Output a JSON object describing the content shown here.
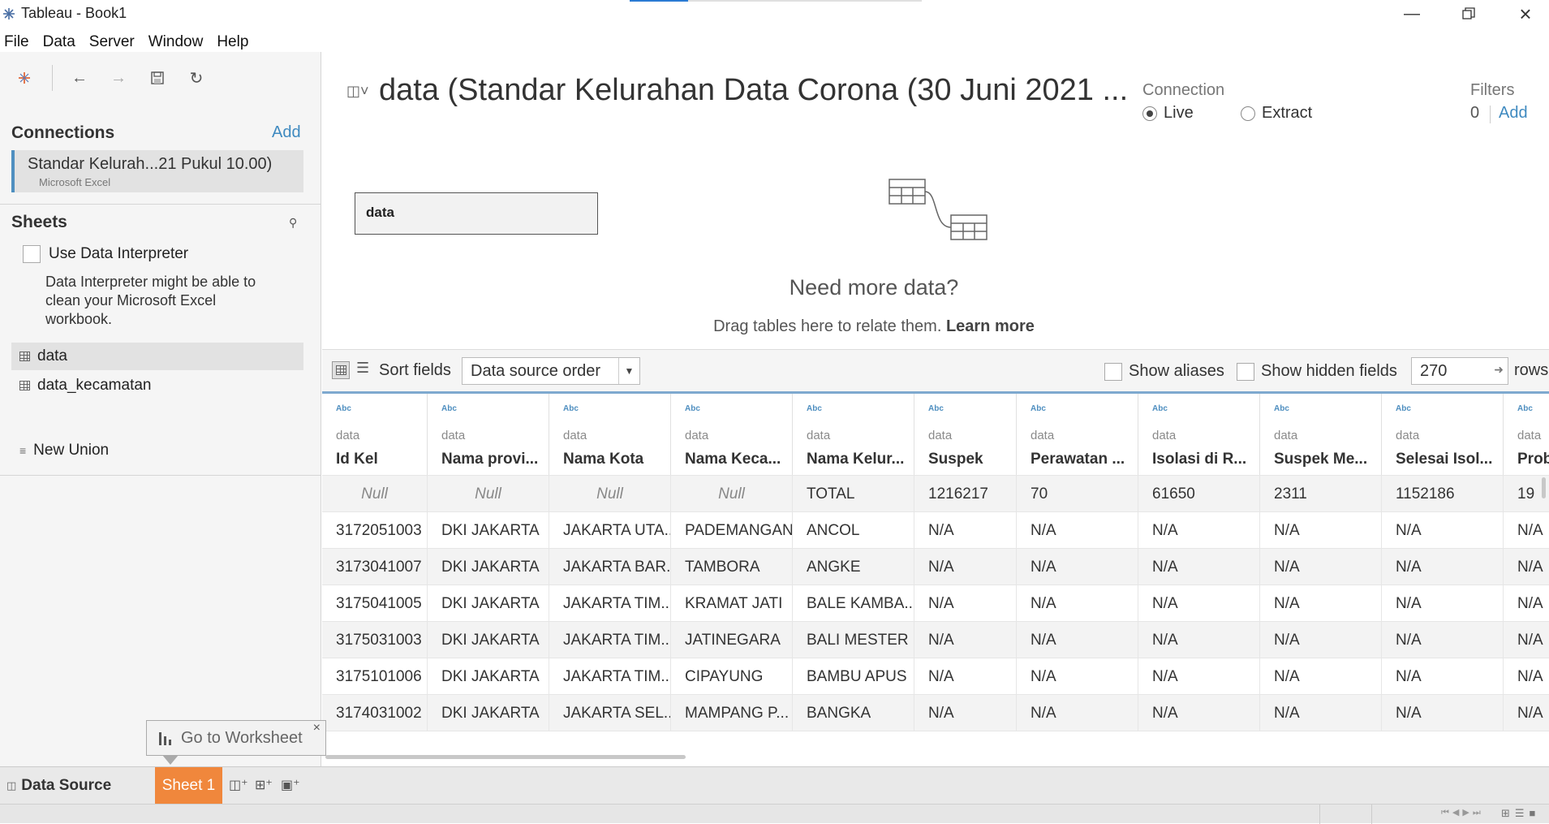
{
  "window": {
    "title": "Tableau - Book1"
  },
  "menu": [
    "File",
    "Data",
    "Server",
    "Window",
    "Help"
  ],
  "left": {
    "connections_heading": "Connections",
    "connections_add": "Add",
    "connection_name": "Standar Kelurah...21 Pukul 10.00)",
    "connection_type": "Microsoft Excel",
    "sheets_heading": "Sheets",
    "use_interpreter": "Use Data Interpreter",
    "interpreter_note": "Data Interpreter might be able to clean your Microsoft Excel workbook.",
    "sheets": [
      "data",
      "data_kecamatan"
    ],
    "new_union": "New Union"
  },
  "canvas": {
    "title": "data (Standar Kelurahan Data Corona (30 Juni 2021 ...",
    "connection_label": "Connection",
    "live_label": "Live",
    "extract_label": "Extract",
    "filters_label": "Filters",
    "filters_count": "0",
    "filters_add": "Add",
    "table_pill": "data",
    "need_more": "Need more data?",
    "drag_text": "Drag tables here to relate them.",
    "learn_more": "Learn more"
  },
  "gridbar": {
    "sort_label": "Sort fields",
    "sort_value": "Data source order",
    "show_aliases": "Show aliases",
    "show_hidden": "Show hidden fields",
    "rows_value": "270",
    "rows_label": "rows"
  },
  "grid": {
    "type_label": "Abc",
    "source_label": "data",
    "columns": [
      "Id Kel",
      "Nama provi...",
      "Nama Kota",
      "Nama Keca...",
      "Nama Kelur...",
      "Suspek",
      "Perawatan ...",
      "Isolasi di R...",
      "Suspek Me...",
      "Selesai Isol...",
      "Prob"
    ],
    "rows": [
      [
        "Null",
        "Null",
        "Null",
        "Null",
        "TOTAL",
        "1216217",
        "70",
        "61650",
        "2311",
        "1152186",
        "19"
      ],
      [
        "3172051003",
        "DKI JAKARTA",
        "JAKARTA UTA...",
        "PADEMANGAN",
        "ANCOL",
        "N/A",
        "N/A",
        "N/A",
        "N/A",
        "N/A",
        "N/A"
      ],
      [
        "3173041007",
        "DKI JAKARTA",
        "JAKARTA BAR...",
        "TAMBORA",
        "ANGKE",
        "N/A",
        "N/A",
        "N/A",
        "N/A",
        "N/A",
        "N/A"
      ],
      [
        "3175041005",
        "DKI JAKARTA",
        "JAKARTA TIM...",
        "KRAMAT JATI",
        "BALE KAMBA...",
        "N/A",
        "N/A",
        "N/A",
        "N/A",
        "N/A",
        "N/A"
      ],
      [
        "3175031003",
        "DKI JAKARTA",
        "JAKARTA TIM...",
        "JATINEGARA",
        "BALI MESTER",
        "N/A",
        "N/A",
        "N/A",
        "N/A",
        "N/A",
        "N/A"
      ],
      [
        "3175101006",
        "DKI JAKARTA",
        "JAKARTA TIM...",
        "CIPAYUNG",
        "BAMBU APUS",
        "N/A",
        "N/A",
        "N/A",
        "N/A",
        "N/A",
        "N/A"
      ],
      [
        "3174031002",
        "DKI JAKARTA",
        "JAKARTA SEL...",
        "MAMPANG P...",
        "BANGKA",
        "N/A",
        "N/A",
        "N/A",
        "N/A",
        "N/A",
        "N/A"
      ]
    ]
  },
  "tabs": {
    "data_source": "Data Source",
    "sheet1": "Sheet 1",
    "go_to_worksheet": "Go to Worksheet"
  },
  "colors": {
    "accent": "#3f8ac0",
    "sheet_tab": "#f0873c"
  }
}
